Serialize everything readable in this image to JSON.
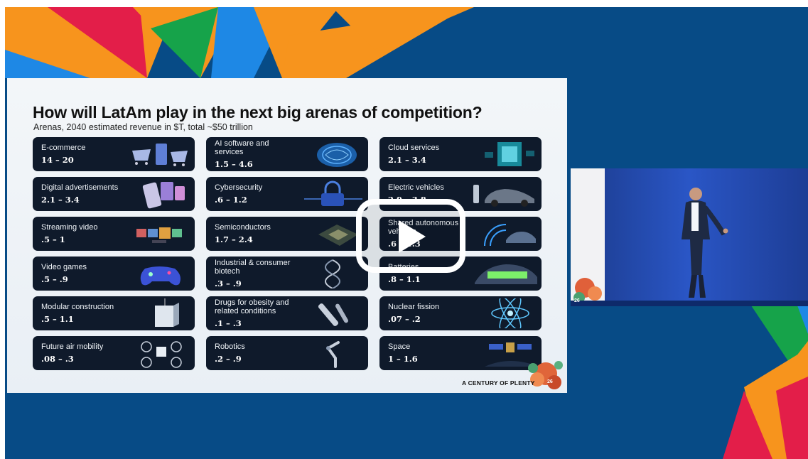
{
  "slide": {
    "title": "How will LatAm play in the next big arenas of competition?",
    "subtitle": "Arenas, 2040 estimated revenue in $T, total ~$50 trillion",
    "cards": [
      {
        "label": "E-commerce",
        "value": "14 – 20",
        "icon": "shopping-carts-icon"
      },
      {
        "label": "AI software and services",
        "value": "1.5 – 4.6",
        "icon": "ai-brain-icon"
      },
      {
        "label": "Cloud services",
        "value": "2.1 – 3.4",
        "icon": "cloud-cube-icon"
      },
      {
        "label": "Digital advertisements",
        "value": "2.1 – 3.4",
        "icon": "phone-ads-icon"
      },
      {
        "label": "Cybersecurity",
        "value": ".6 – 1.2",
        "icon": "padlock-icon"
      },
      {
        "label": "Electric vehicles",
        "value": "2.9 – 3.8",
        "icon": "car-icon"
      },
      {
        "label": "Streaming video",
        "value": ".5 – 1",
        "icon": "video-tiles-icon"
      },
      {
        "label": "Semiconductors",
        "value": "1.7 – 2.4",
        "icon": "chip-icon"
      },
      {
        "label": "Shared autonomous vehicles",
        "value": ".6 – 1.3",
        "icon": "autonomous-car-icon"
      },
      {
        "label": "Video games",
        "value": ".5 – .9",
        "icon": "gamepad-icon"
      },
      {
        "label": "Industrial & consumer biotech",
        "value": ".3 – .9",
        "icon": "dna-icon"
      },
      {
        "label": "Batteries",
        "value": ".8 – 1.1",
        "icon": "battery-car-icon"
      },
      {
        "label": "Modular construction",
        "value": ".5 – 1.1",
        "icon": "building-module-icon"
      },
      {
        "label": "Drugs for obesity and related conditions",
        "value": ".1 – .3",
        "icon": "injection-pen-icon"
      },
      {
        "label": "Nuclear fission",
        "value": ".07 – .2",
        "icon": "atom-icon"
      },
      {
        "label": "Future air mobility",
        "value": ".08 – .3",
        "icon": "drone-icon"
      },
      {
        "label": "Robotics",
        "value": ".2 – .9",
        "icon": "robot-arm-icon"
      },
      {
        "label": "Space",
        "value": "1 – 1.6",
        "icon": "satellite-icon"
      }
    ],
    "brand": "A CENTURY OF PLENTY",
    "page_number": "26"
  },
  "speaker_inset": {
    "page_number": "26"
  },
  "player": {
    "play_icon": "play-icon"
  },
  "colors": {
    "background": "#074b86",
    "card": "#0f1a2b",
    "accent_orange": "#f7941d",
    "accent_red": "#e31e49",
    "accent_green": "#16a34a",
    "accent_blue": "#1e88e5"
  }
}
